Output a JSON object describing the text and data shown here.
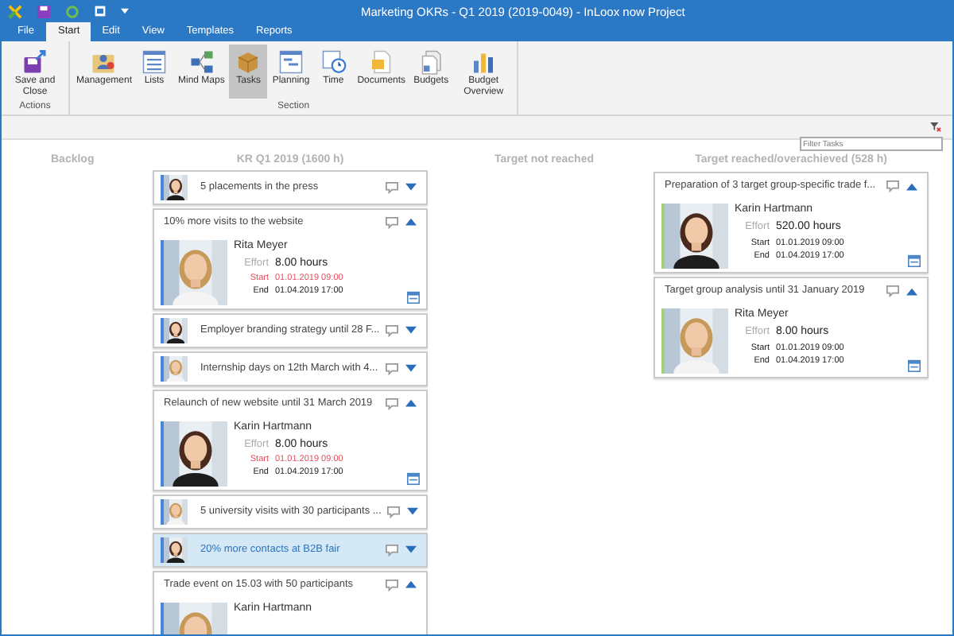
{
  "window": {
    "title": "Marketing OKRs - Q1 2019 (2019-0049) - InLoox now Project"
  },
  "ribbon_tabs": [
    {
      "label": "File",
      "selected": false,
      "kind": "file"
    },
    {
      "label": "Start",
      "selected": true,
      "kind": "tab"
    },
    {
      "label": "Edit",
      "selected": false,
      "kind": "tab"
    },
    {
      "label": "View",
      "selected": false,
      "kind": "tab"
    },
    {
      "label": "Templates",
      "selected": false,
      "kind": "tab"
    },
    {
      "label": "Reports",
      "selected": false,
      "kind": "tab"
    }
  ],
  "ribbon_groups": [
    {
      "label": "Actions",
      "buttons": [
        {
          "label": "Save and Close",
          "selected": false
        }
      ]
    },
    {
      "label": "Section",
      "buttons": [
        {
          "label": "Management",
          "selected": false
        },
        {
          "label": "Lists",
          "selected": false
        },
        {
          "label": "Mind Maps",
          "selected": false
        },
        {
          "label": "Tasks",
          "selected": true
        },
        {
          "label": "Planning",
          "selected": false
        },
        {
          "label": "Time",
          "selected": false
        },
        {
          "label": "Documents",
          "selected": false
        },
        {
          "label": "Budgets",
          "selected": false
        },
        {
          "label": "Budget Overview",
          "selected": false
        }
      ]
    }
  ],
  "filter": {
    "placeholder": "Filter Tasks"
  },
  "columns": [
    {
      "title": "Backlog"
    },
    {
      "title": "KR Q1 2019 (1600 h)",
      "color": "#4a86d8",
      "cards": [
        {
          "title": "5 placements in the press",
          "expanded": false,
          "selected": false
        },
        {
          "title": "10% more visits to the website",
          "expanded": true,
          "selected": false,
          "person": "Rita Meyer",
          "effort_label": "Effort",
          "effort": "8.00 hours",
          "start_label": "Start",
          "start": "01.01.2019 09:00",
          "start_overdue": true,
          "end_label": "End",
          "end": "01.04.2019 17:00"
        },
        {
          "title": "Employer branding strategy until 28 F...",
          "expanded": false,
          "selected": false
        },
        {
          "title": "Internship days on 12th March with 4...",
          "expanded": false,
          "selected": false
        },
        {
          "title": "Relaunch of new website until 31 March 2019",
          "expanded": true,
          "selected": false,
          "person": "Karin Hartmann",
          "effort_label": "Effort",
          "effort": "8.00 hours",
          "start_label": "Start",
          "start": "01.01.2019 09:00",
          "start_overdue": true,
          "end_label": "End",
          "end": "01.04.2019 17:00"
        },
        {
          "title": "5 university visits with 30 participants ...",
          "expanded": false,
          "selected": false
        },
        {
          "title": "20% more contacts at B2B fair",
          "expanded": false,
          "selected": true
        },
        {
          "title": "Trade event on 15.03 with 50 participants",
          "expanded": true,
          "selected": false,
          "person": "Karin Hartmann"
        }
      ]
    },
    {
      "title": "Target not reached"
    },
    {
      "title": "Target reached/overachieved (528 h)",
      "color": "#a6cf7a",
      "cards": [
        {
          "title": "Preparation of 3 target group-specific trade f...",
          "expanded": true,
          "selected": false,
          "person": "Karin Hartmann",
          "effort_label": "Effort",
          "effort": "520.00 hours",
          "start_label": "Start",
          "start": "01.01.2019 09:00",
          "start_overdue": false,
          "end_label": "End",
          "end": "01.04.2019 17:00"
        },
        {
          "title": "Target group analysis until 31 January 2019",
          "expanded": true,
          "selected": false,
          "person": "Rita Meyer",
          "effort_label": "Effort",
          "effort": "8.00 hours",
          "start_label": "Start",
          "start": "01.01.2019 09:00",
          "start_overdue": false,
          "end_label": "End",
          "end": "01.04.2019 17:00"
        }
      ]
    }
  ]
}
